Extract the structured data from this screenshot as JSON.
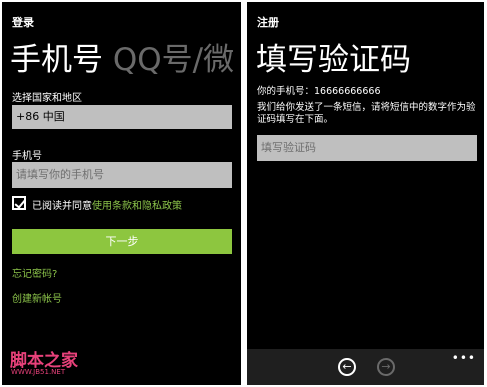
{
  "login": {
    "header": "登录",
    "title_main": "手机号",
    "title_next": "QQ号/微",
    "region_label": "选择国家和地区",
    "region_value": "+86 中国",
    "phone_label": "手机号",
    "phone_placeholder": "请填写你的手机号",
    "agree_prefix": "已阅读并同意",
    "agree_link": "使用条款和隐私政策",
    "next_button": "下一步",
    "forgot_password": "忘记密码?",
    "create_account": "创建新帐号"
  },
  "register": {
    "header": "注册",
    "title": "填写验证码",
    "phone_line": "你的手机号：16666666666",
    "instructions": "我们给你发送了一条短信，请将短信中的数字作为验证码填写在下面。",
    "code_placeholder": "填写验证码"
  },
  "watermark": {
    "text": "脚本之家",
    "url": "WWW.JB51.NET"
  },
  "colors": {
    "accent": "#8dc63f",
    "background": "#000000",
    "field": "#bfbfbf"
  },
  "icons": {
    "back": "arrow-left-icon",
    "forward": "arrow-right-icon",
    "more": "more-dots-icon"
  }
}
